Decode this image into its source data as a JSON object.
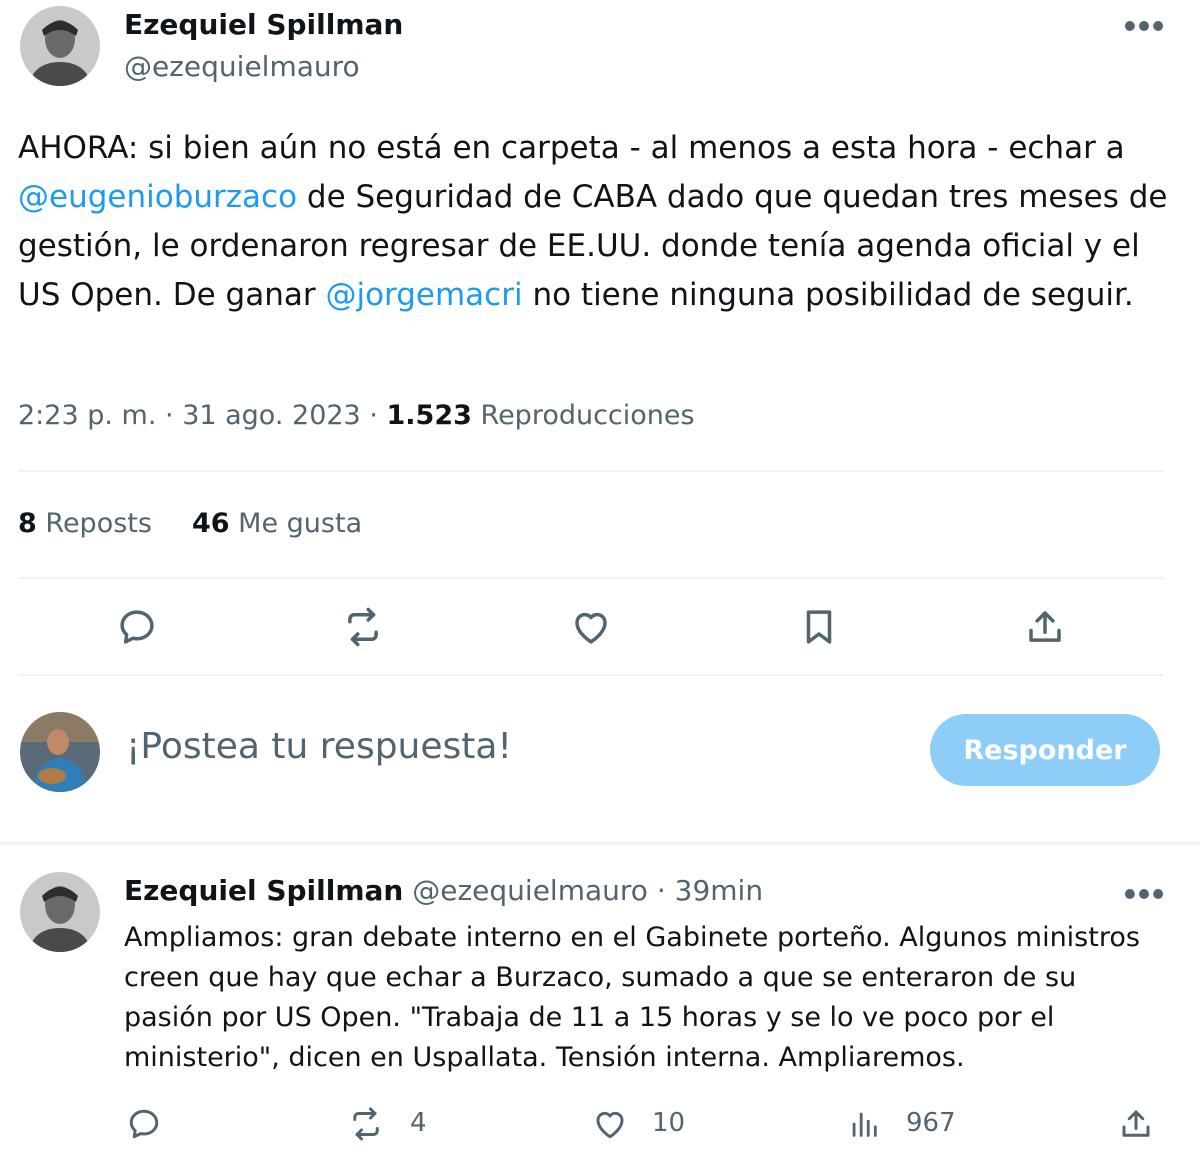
{
  "main_tweet": {
    "author_name": "Ezequiel Spillman",
    "author_handle": "@ezequielmauro",
    "text": {
      "p1": "AHORA: si bien aún no está en carpeta - al menos a esta hora - echar a ",
      "mention1": "@eugenioburzaco",
      "p2": " de Seguridad de CABA dado que quedan tres meses de gestión, le ordenaron regresar de EE.UU. donde tenía agenda oficial y el US Open. De ganar ",
      "mention2": "@jorgemacri",
      "p3": " no tiene ninguna posibilidad de seguir."
    },
    "time": "2:23 p. m.",
    "dot": "·",
    "date": "31 ago. 2023",
    "views_count": "1.523",
    "views_label": "Reproducciones",
    "reposts_count": "8",
    "reposts_label": "Reposts",
    "likes_count": "46",
    "likes_label": "Me gusta",
    "actions": [
      "reply-icon",
      "repost-icon",
      "like-icon",
      "bookmark-icon",
      "share-icon"
    ]
  },
  "composer": {
    "placeholder": "¡Postea tu respuesta!",
    "button_label": "Responder"
  },
  "reply_tweet": {
    "author_name": "Ezequiel Spillman",
    "author_handle": "@ezequielmauro",
    "dot": "·",
    "time_ago": "39min",
    "text": "Ampliamos: gran debate interno en el Gabinete porteño. Algunos ministros creen que hay que echar a Burzaco, sumado a que se enteraron de su pasión por US Open. \"Trabaja de 11 a 15 horas y se lo ve poco por el ministerio\", dicen en Uspallata. Tensión interna. Ampliaremos.",
    "reply_count": "",
    "repost_count": "4",
    "like_count": "10",
    "views_count": "967"
  },
  "colors": {
    "accent": "#1d9bf0",
    "button_disabled": "#8ecdf8",
    "muted": "#536471",
    "divider": "#eff3f4"
  }
}
